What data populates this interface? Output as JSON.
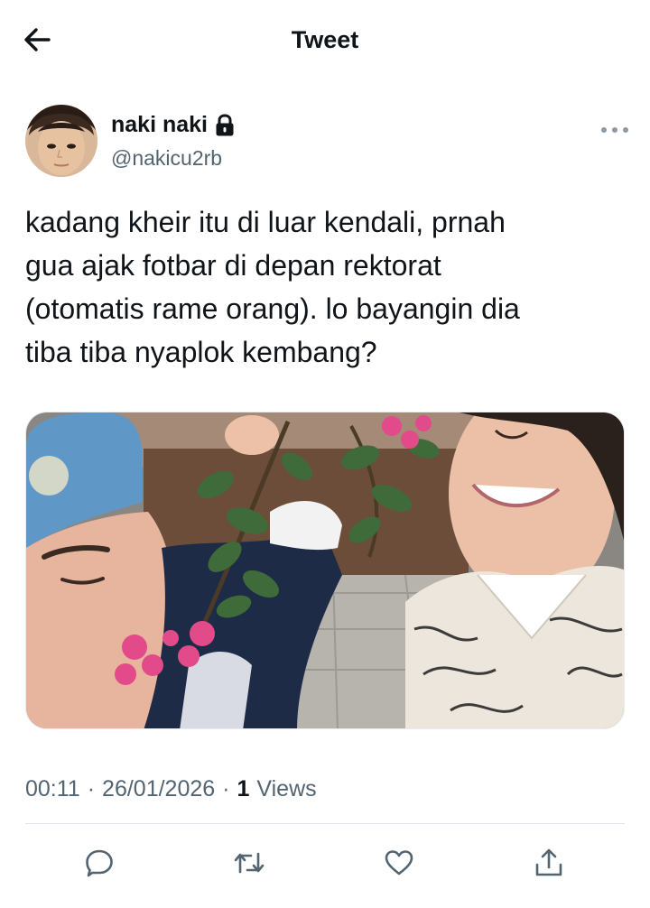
{
  "header": {
    "title": "Tweet",
    "back_icon": "arrow-left-icon"
  },
  "tweet": {
    "author": {
      "display_name": "naki naki",
      "handle": "@nakicu2rb",
      "protected_icon": "lock-icon"
    },
    "text": "kadang kheir itu di luar kendali, prnah\ngua ajak fotbar di depan rektorat\n(otomatis rame orang). lo bayangin dia\ntiba tiba nyaplok kembang?",
    "time": "00:11",
    "separator": "·",
    "date": "26/01/2026",
    "views_count": "1",
    "views_label": "Views"
  },
  "actions": [
    {
      "name": "reply",
      "icon": "reply-icon"
    },
    {
      "name": "retweet",
      "icon": "retweet-icon"
    },
    {
      "name": "like",
      "icon": "heart-icon"
    },
    {
      "name": "share",
      "icon": "share-icon"
    }
  ],
  "colors": {
    "text_primary": "#0f1419",
    "text_secondary": "#536471",
    "icon": "#536471",
    "divider": "#dfe5ea"
  }
}
